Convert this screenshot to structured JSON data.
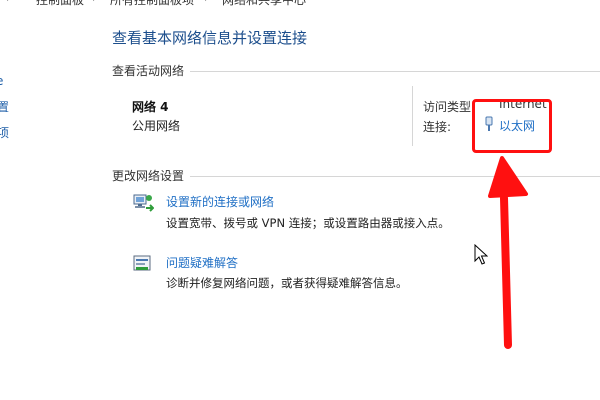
{
  "breadcrumb": {
    "items": [
      "控制面板",
      "所有控制面板项",
      "网络和共享中心"
    ]
  },
  "left_nav": {
    "items": [
      "e",
      "置",
      "项"
    ]
  },
  "page": {
    "title": "查看基本网络信息并设置连接"
  },
  "active_networks": {
    "header": "查看活动网络",
    "network_name": "网络 4",
    "network_type": "公用网络",
    "access_type_label": "访问类型:",
    "access_type_value": "Internet",
    "connection_label": "连接:",
    "connection_value": "以太网"
  },
  "change_settings": {
    "header": "更改网络设置",
    "items": [
      {
        "link": "设置新的连接或网络",
        "desc": "设置宽带、拨号或 VPN 连接；或设置路由器或接入点。",
        "icon": "network-setup-icon"
      },
      {
        "link": "问题疑难解答",
        "desc": "诊断并修复网络问题，或者获得疑难解答信息。",
        "icon": "troubleshoot-icon"
      }
    ]
  },
  "colors": {
    "title": "#1c4e8c",
    "link": "#1f6fc5",
    "annotation": "#ff1010"
  }
}
